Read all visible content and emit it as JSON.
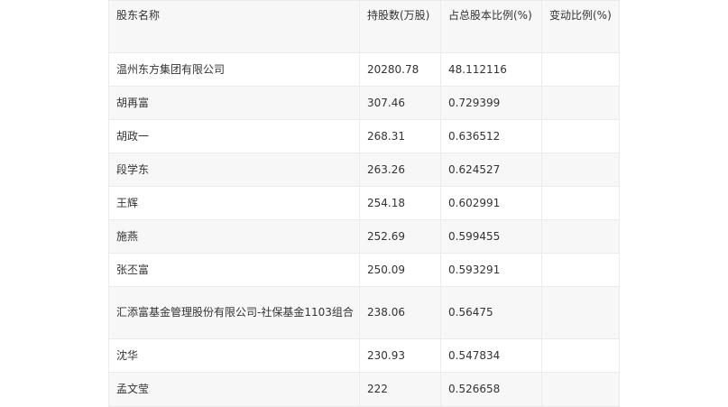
{
  "table": {
    "headers": [
      "股东名称",
      "持股数(万股)",
      "占总股本比例(%)",
      "变动比例(%)"
    ],
    "rows": [
      [
        "温州东方集团有限公司",
        "20280.78",
        "48.112116",
        ""
      ],
      [
        "胡再富",
        "307.46",
        "0.729399",
        ""
      ],
      [
        "胡政一",
        "268.31",
        "0.636512",
        ""
      ],
      [
        "段学东",
        "263.26",
        "0.624527",
        ""
      ],
      [
        "王辉",
        "254.18",
        "0.602991",
        ""
      ],
      [
        "施燕",
        "252.69",
        "0.599455",
        ""
      ],
      [
        "张丕富",
        "250.09",
        "0.593291",
        ""
      ],
      [
        "汇添富基金管理股份有限公司-社保基金1103组合",
        "238.06",
        "0.56475",
        ""
      ],
      [
        "沈华",
        "230.93",
        "0.547834",
        ""
      ],
      [
        "孟文莹",
        "222",
        "0.526658",
        ""
      ]
    ]
  }
}
